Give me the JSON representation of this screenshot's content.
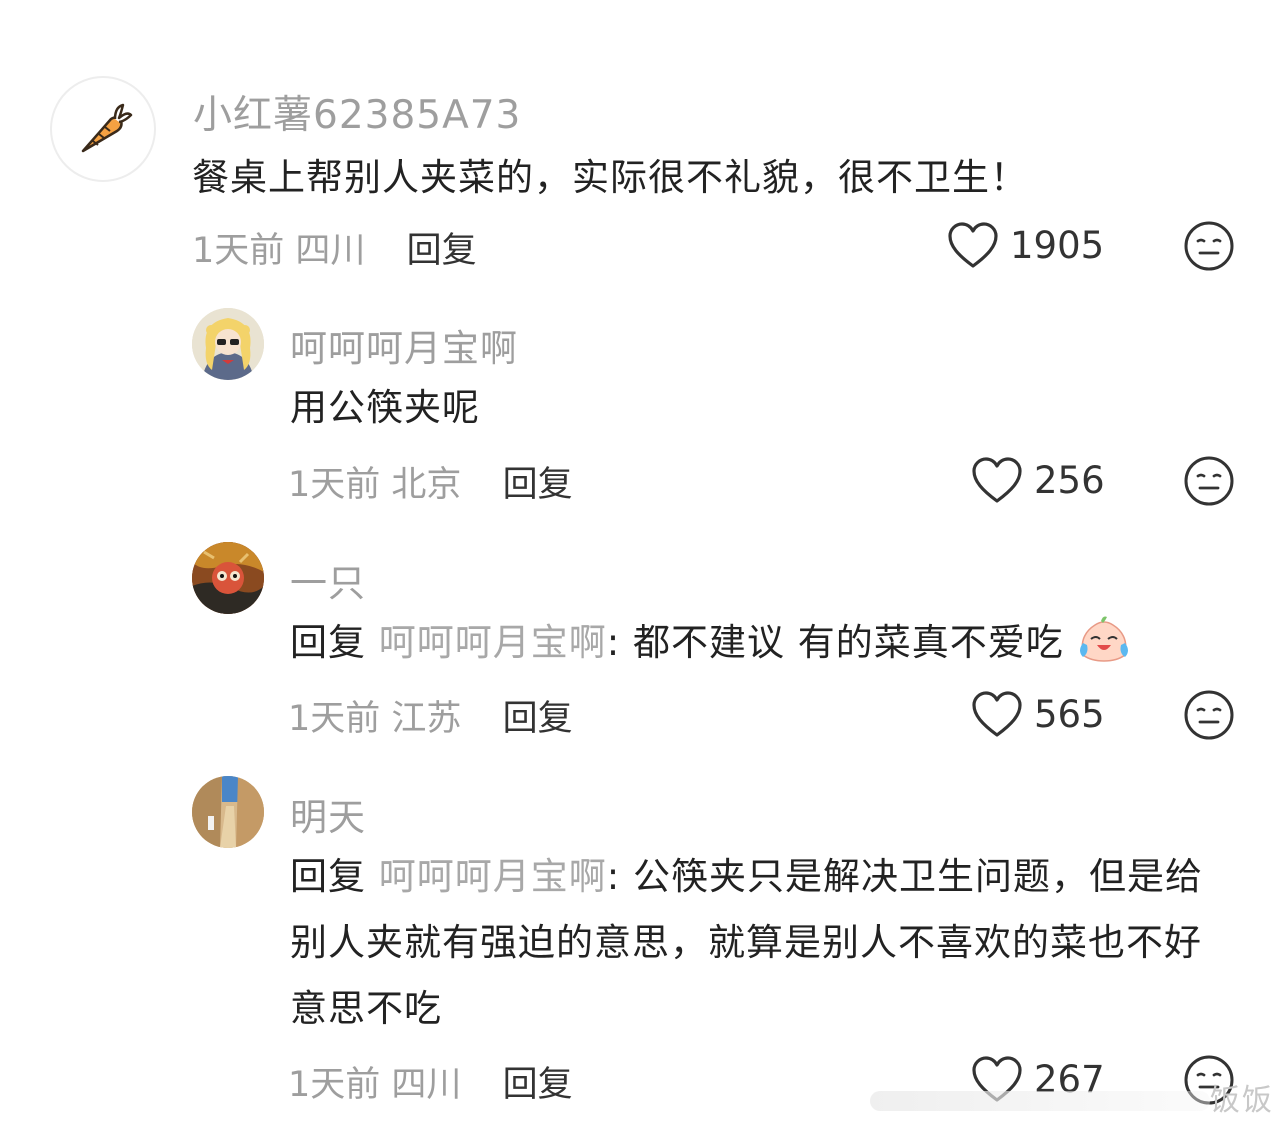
{
  "comments": [
    {
      "username": "小红薯62385A73",
      "text": "餐桌上帮别人夹菜的，实际很不礼貌，很不卫生！",
      "time": "1天前",
      "location": "四川",
      "reply_label": "回复",
      "likes": "1905",
      "avatar": "carrot-icon"
    },
    {
      "username": "呵呵呵月宝啊",
      "text": "用公筷夹呢",
      "time": "1天前",
      "location": "北京",
      "reply_label": "回复",
      "likes": "256",
      "avatar": "anime-girl-avatar"
    },
    {
      "username": "一只",
      "reply_prefix": "回复",
      "reply_to": "呵呵呵月宝啊",
      "text": ": 都不建议 有的菜真不爱吃",
      "time": "1天前",
      "location": "江苏",
      "reply_label": "回复",
      "likes": "565",
      "avatar": "painted-face-avatar",
      "emoji": "crying-laughing-emoji"
    },
    {
      "username": "明天",
      "reply_prefix": "回复",
      "reply_to": "呵呵呵月宝啊",
      "text": ": 公筷夹只是解决卫生问题，但是给别人夹就有强迫的意思，就算是别人不喜欢的菜也不好意思不吃",
      "time": "1天前",
      "location": "四川",
      "reply_label": "回复",
      "likes": "267",
      "avatar": "street-photo-avatar"
    }
  ],
  "watermark": "饭饭"
}
